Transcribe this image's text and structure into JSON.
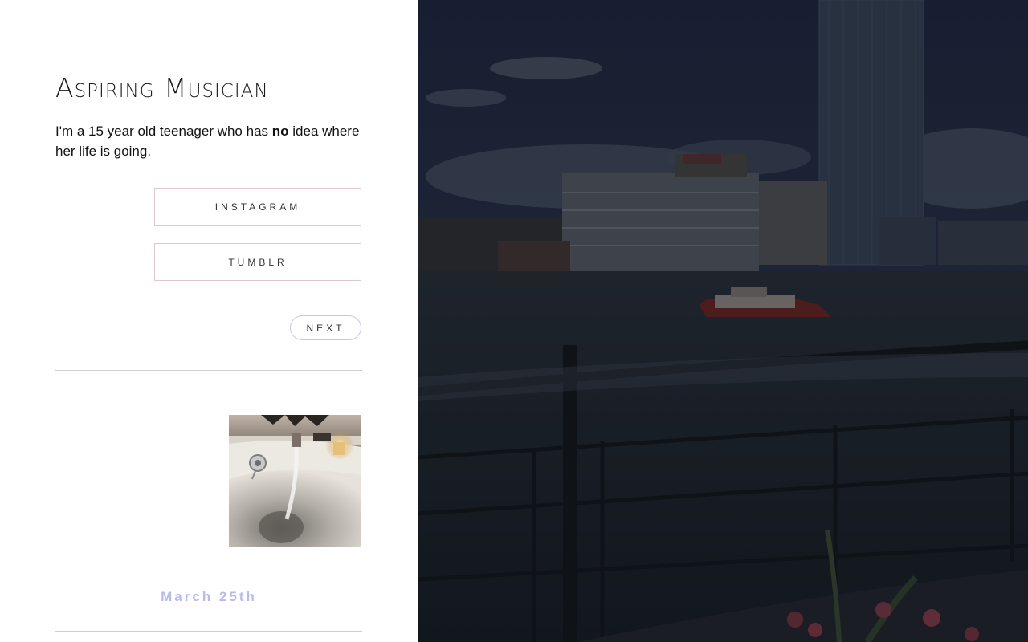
{
  "blog": {
    "title": "Aspiring Musician",
    "description": {
      "before": "I'm a 15 year old teenager who has ",
      "emphasis": "no",
      "after": " idea where her life is going."
    }
  },
  "links": {
    "instagram_label": "INSTAGRAM",
    "tumblr_label": "TUMBLR"
  },
  "pagination": {
    "next_label": "NEXT"
  },
  "posts": [
    {
      "image": "bathtub-with-running-tap-photo",
      "date": "March 25th"
    }
  ],
  "background": {
    "image": "river-waterfront-city-skyline-photo",
    "overlay_color": "#1b2232"
  },
  "colors": {
    "button_border": "#e2c7d1",
    "next_border": "#c6c8e8",
    "date_text": "#b7bbe6"
  }
}
